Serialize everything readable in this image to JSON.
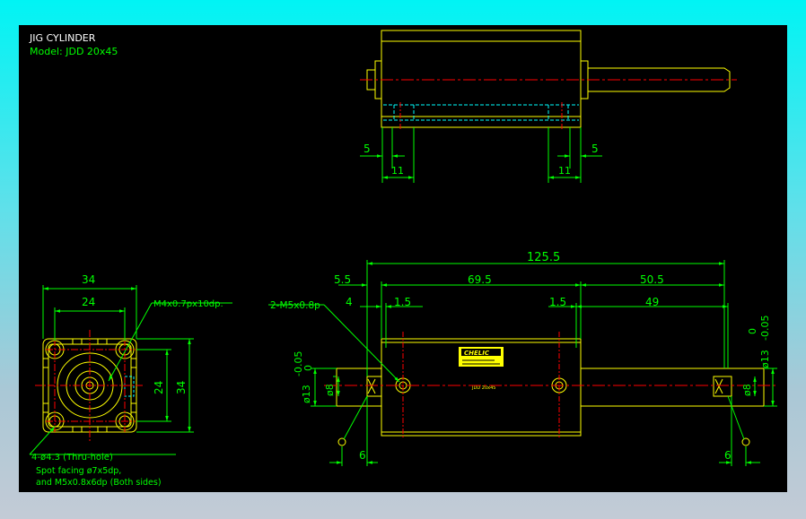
{
  "title": {
    "line1": "JIG CYLINDER",
    "line2": "Model:  JDD 20x45"
  },
  "top_view": {
    "dim_left_5": "5",
    "dim_right_5": "5",
    "dim_left_11": "11",
    "dim_right_11": "11"
  },
  "end_view": {
    "width_outer": "34",
    "width_inner": "24",
    "height_inner": "24",
    "height_outer": "34",
    "thread_note": "M4x0.7px10dp.",
    "hole_note": "4-ø4.3 (Thru-hole)",
    "spot_note_1": "Spot facing ø7x5dp,",
    "spot_note_2": "and M5x0.8x6dp (Both sides)"
  },
  "side_view": {
    "overall": "125.5",
    "offset_left": "5.5",
    "body": "69.5",
    "right_len": "50.5",
    "port_offset": "4",
    "left_1_5": "1.5",
    "right_1_5": "1.5",
    "rod_49": "49",
    "port_note": "2-M5x0.8p",
    "rod_dia_left": "ø8",
    "rod_dia_right": "ø8",
    "left_tol_dia": "ø13",
    "left_tol_upper": "0",
    "left_tol_lower": "-0.05",
    "right_tol_dia": "ø13",
    "right_tol_upper": "0",
    "right_tol_lower": "-0.05",
    "left_6": "6",
    "right_6": "6",
    "label_brand": "CHELIC",
    "label_small": "JDD 20x45"
  },
  "colors": {
    "outline": "#ffff00",
    "dimension": "#00ff00",
    "center": "#ff0000",
    "hidden": "#00ffff",
    "text_white": "#ffffff",
    "background": "#000000"
  }
}
